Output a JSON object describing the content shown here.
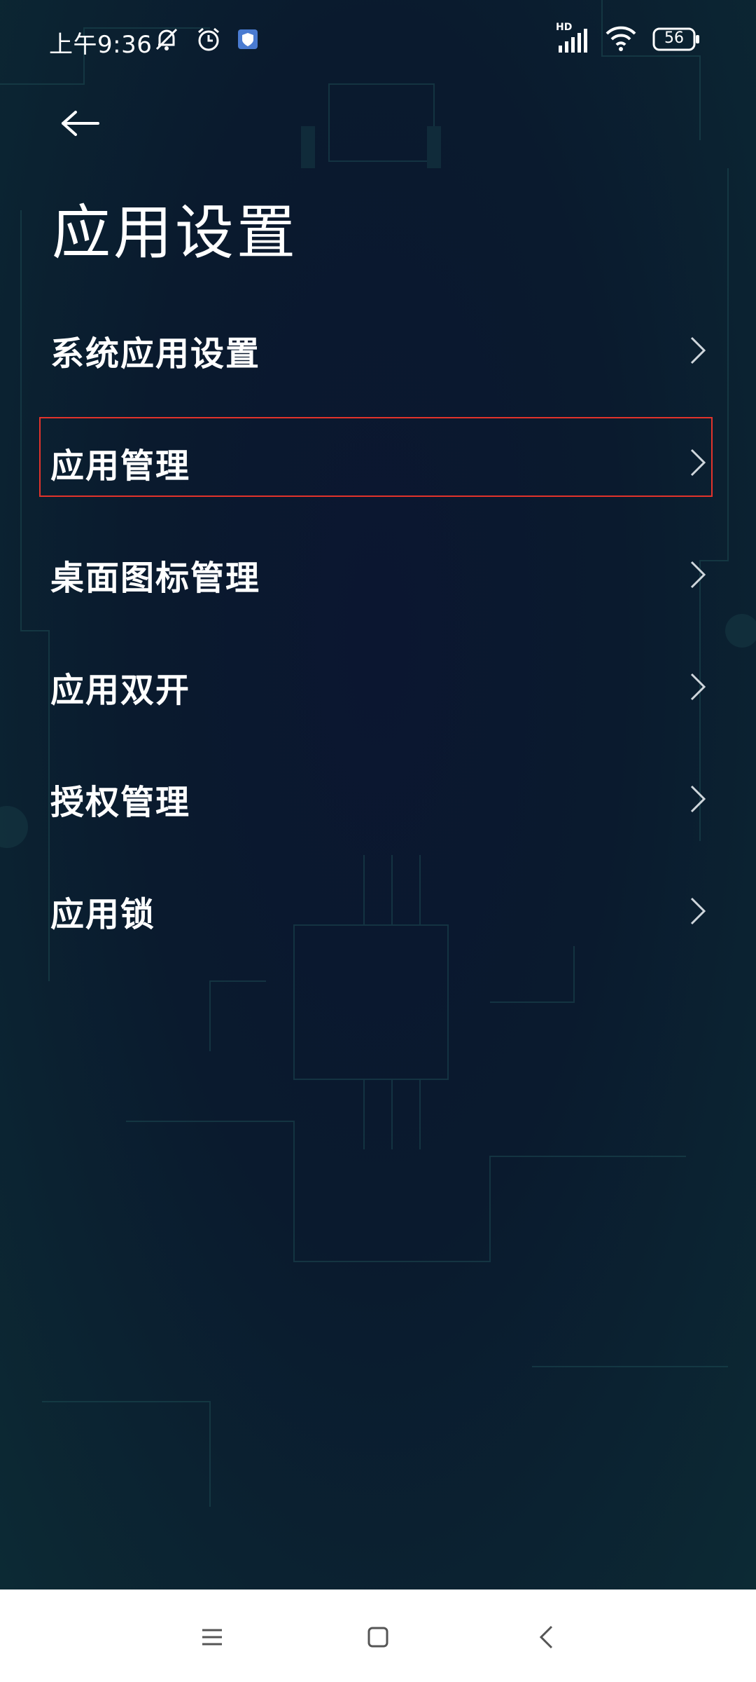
{
  "status_bar": {
    "time": "上午9:36",
    "icons_left": [
      "mute-bell-icon",
      "alarm-icon",
      "shield-app-icon"
    ],
    "signal_label": "HD",
    "icons_right": [
      "signal-icon",
      "wifi-icon",
      "battery-icon"
    ],
    "battery": "56"
  },
  "header": {
    "back_icon": "back-arrow-icon",
    "title": "应用设置"
  },
  "menu": {
    "items": [
      {
        "label": "系统应用设置"
      },
      {
        "label": "应用管理"
      },
      {
        "label": "桌面图标管理"
      },
      {
        "label": "应用双开"
      },
      {
        "label": "授权管理"
      },
      {
        "label": "应用锁"
      }
    ]
  },
  "nav_bar": {
    "icons": [
      "menu-icon",
      "home-icon",
      "back-icon"
    ]
  },
  "colors": {
    "highlight_border": "#e2332b",
    "text": "#ffffff",
    "nav_bar_bg": "#ffffff"
  }
}
